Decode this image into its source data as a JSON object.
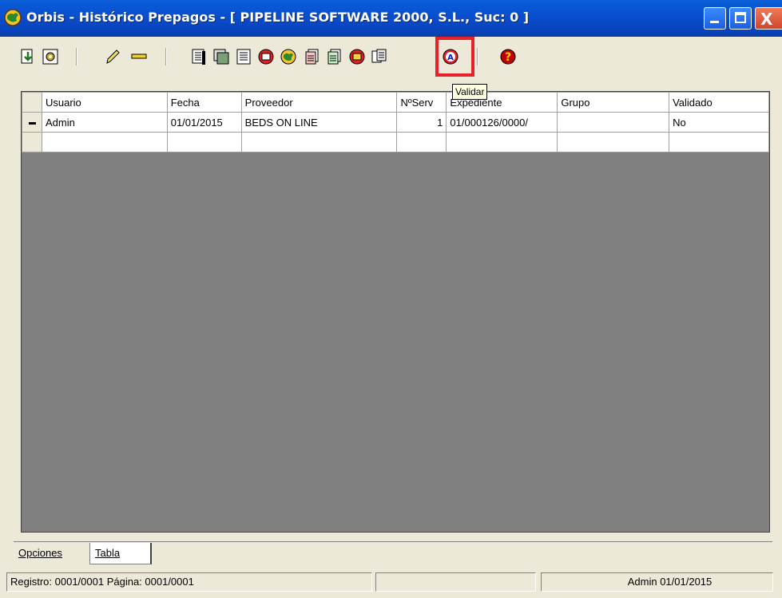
{
  "window": {
    "title": "Orbis - Histórico Prepagos - [ PIPELINE SOFTWARE 2000, S.L.,  Suc: 0 ]",
    "controls": {
      "minimize_glyph": "",
      "maximize_glyph": "",
      "close_glyph": "X"
    }
  },
  "toolbar": {
    "buttons": [
      {
        "icon": "import-icon"
      },
      {
        "icon": "settings-icon"
      },
      {
        "icon": "pencil-icon"
      },
      {
        "icon": "minus-icon"
      },
      {
        "icon": "list-icon"
      },
      {
        "icon": "cards-icon"
      },
      {
        "icon": "document-icon"
      },
      {
        "icon": "print-icon"
      },
      {
        "icon": "globe-icon"
      },
      {
        "icon": "copy-icon"
      },
      {
        "icon": "copy-green-icon"
      },
      {
        "icon": "folder-icon"
      },
      {
        "icon": "pages-icon"
      },
      {
        "icon": "validate-icon"
      },
      {
        "icon": "help-icon"
      }
    ],
    "tooltip": "Validar"
  },
  "grid": {
    "columns": [
      "Usuario",
      "Fecha",
      "Proveedor",
      "NºServ",
      "Expediente",
      "Grupo",
      "Validado"
    ],
    "rows": [
      [
        "Admin",
        "01/01/2015",
        "BEDS ON LINE",
        "1",
        "01/000126/0000/",
        "",
        "No"
      ],
      [
        "",
        "",
        "",
        "",
        "",
        "",
        ""
      ]
    ]
  },
  "tabs": [
    {
      "label": "Opciones",
      "active": false
    },
    {
      "label": "Tabla",
      "active": true
    }
  ],
  "status": {
    "left": "Registro: 0001/0001  Página: 0001/0001",
    "middle": "",
    "right": "Admin 01/01/2015"
  },
  "colors": {
    "titlebar": "#0a4fd0",
    "highlight": "#e8202a",
    "grid_background": "#808080"
  }
}
